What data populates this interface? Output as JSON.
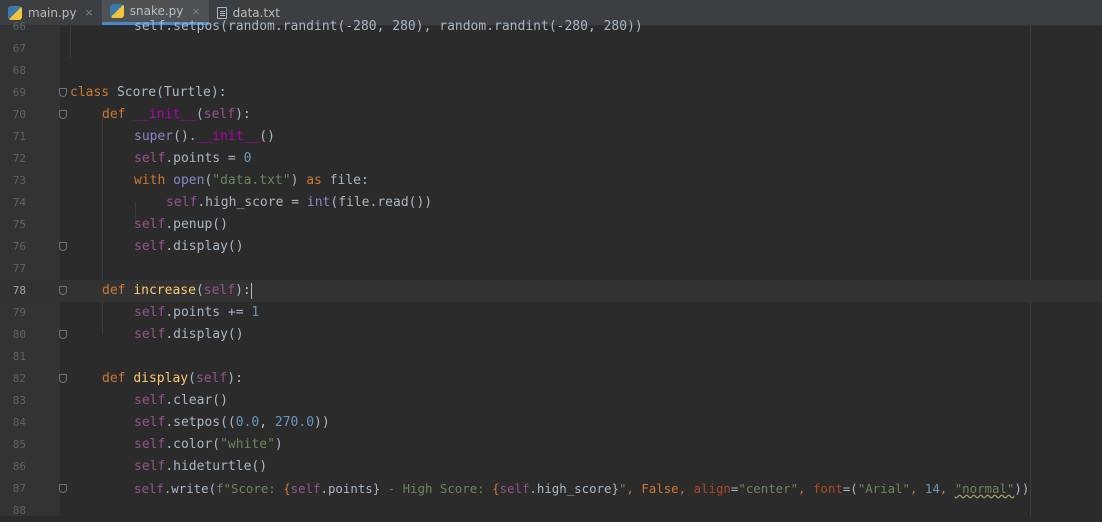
{
  "tabs": [
    {
      "label": "main.py",
      "icon": "python-file-icon",
      "active": false
    },
    {
      "label": "snake.py",
      "icon": "python-file-icon",
      "active": true
    },
    {
      "label": "data.txt",
      "icon": "text-file-icon",
      "active": false
    }
  ],
  "close_glyph": "×",
  "line_numbers": [
    "66",
    "67",
    "68",
    "69",
    "70",
    "71",
    "72",
    "73",
    "74",
    "75",
    "76",
    "77",
    "78",
    "79",
    "80",
    "81",
    "82",
    "83",
    "84",
    "85",
    "86",
    "87",
    "88"
  ],
  "current_line": "78",
  "code": {
    "l66": "self.setpos(random.randint(-280, 280), random.randint(-280, 280))",
    "l69": [
      "class",
      " Score(Turtle):"
    ],
    "l70": [
      "def",
      " ",
      "__init__",
      "(",
      "self",
      "):"
    ],
    "l71": [
      "super",
      "().",
      "__init__",
      "()"
    ],
    "l72": [
      "self",
      ".points = ",
      "0"
    ],
    "l73": [
      "with",
      " ",
      "open",
      "(",
      "\"data.txt\"",
      ") ",
      "as",
      " file:"
    ],
    "l74": [
      "self",
      ".high_score = ",
      "int",
      "(file.read())"
    ],
    "l75": [
      "self",
      ".penup()"
    ],
    "l76": [
      "self",
      ".display()"
    ],
    "l78": [
      "def",
      " ",
      "increase",
      "(",
      "self",
      "):"
    ],
    "l79": [
      "self",
      ".points += ",
      "1"
    ],
    "l80": [
      "self",
      ".display()"
    ],
    "l82": [
      "def",
      " ",
      "display",
      "(",
      "self",
      "):"
    ],
    "l83": [
      "self",
      ".clear()"
    ],
    "l84": [
      "self",
      ".setpos((",
      "0.0",
      ", ",
      "270.0",
      "))"
    ],
    "l85": [
      "self",
      ".color(",
      "\"white\"",
      ")"
    ],
    "l86": [
      "self",
      ".hideturtle()"
    ],
    "l87": [
      "self",
      ".write(",
      "f\"Score: ",
      "{",
      "self",
      ".points}",
      " - High Score: ",
      "{",
      "self",
      ".high_score}",
      "\"",
      ", ",
      "False",
      ", ",
      "align",
      "=",
      "\"center\"",
      ", ",
      "font",
      "=(",
      "\"Arial\"",
      ", ",
      "14",
      ", ",
      "\"normal\"",
      "))"
    ]
  },
  "colors": {
    "background": "#2b2b2b",
    "keyword": "#cc7832",
    "self": "#94558d",
    "string": "#6a8759",
    "number": "#6897bb",
    "function": "#ffc66d"
  }
}
